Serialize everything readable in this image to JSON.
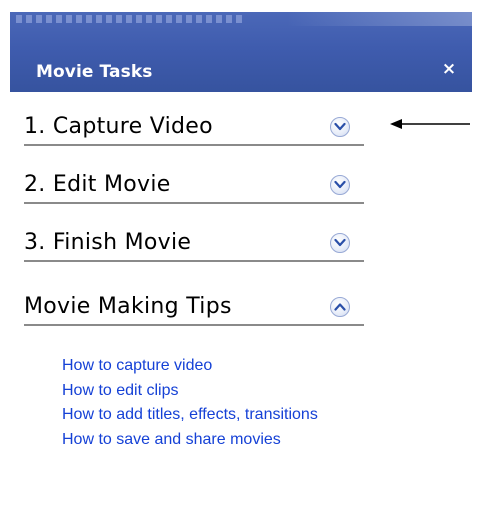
{
  "panel": {
    "title": "Movie Tasks",
    "close_glyph": "×"
  },
  "sections": [
    {
      "label": "1. Capture Video",
      "state": "collapsed",
      "icon": "chevron-down-icon"
    },
    {
      "label": "2. Edit Movie",
      "state": "collapsed",
      "icon": "chevron-down-icon"
    },
    {
      "label": "3. Finish Movie",
      "state": "collapsed",
      "icon": "chevron-down-icon"
    },
    {
      "label": "Movie Making Tips",
      "state": "expanded",
      "icon": "chevron-up-icon"
    }
  ],
  "tips_links": [
    "How to capture video",
    "How to edit clips",
    "How to add titles, effects, transitions",
    "How to save and share movies"
  ],
  "colors": {
    "header_blue": "#3f5cae",
    "link_blue": "#1541d6",
    "chevron_blue": "#2a4fa8"
  }
}
